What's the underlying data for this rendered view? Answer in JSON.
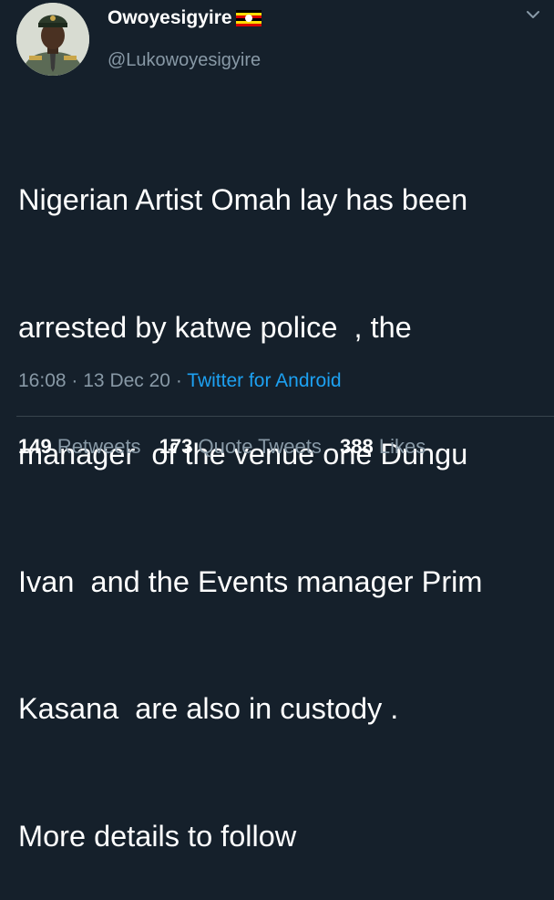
{
  "colors": {
    "background": "#15202b",
    "primary_text": "#ffffff",
    "secondary_text": "#8899a6",
    "link": "#1da1f2",
    "divider": "#38444d"
  },
  "author": {
    "display_name": "Owoyesigyire",
    "handle": "@Lukowoyesigyire",
    "flag_icon": "uganda-flag-icon",
    "avatar_icon": "profile-photo-icon"
  },
  "tweet": {
    "lines": [
      "Nigerian Artist Omah lay has been",
      "arrested by katwe police  , the",
      "manager  of the venue one Dungu",
      "Ivan  and the Events manager Prim",
      "Kasana  are also in custody .",
      "More details to follow"
    ],
    "time": "16:08",
    "date": "13 Dec 20",
    "separator": "·",
    "source": "Twitter for Android"
  },
  "stats": {
    "retweets_count": "149",
    "retweets_label": "Retweets",
    "quotes_count": "173",
    "quotes_label": "Quote Tweets",
    "likes_count": "388",
    "likes_label": "Likes"
  },
  "menu_icon": "chevron-down-icon"
}
